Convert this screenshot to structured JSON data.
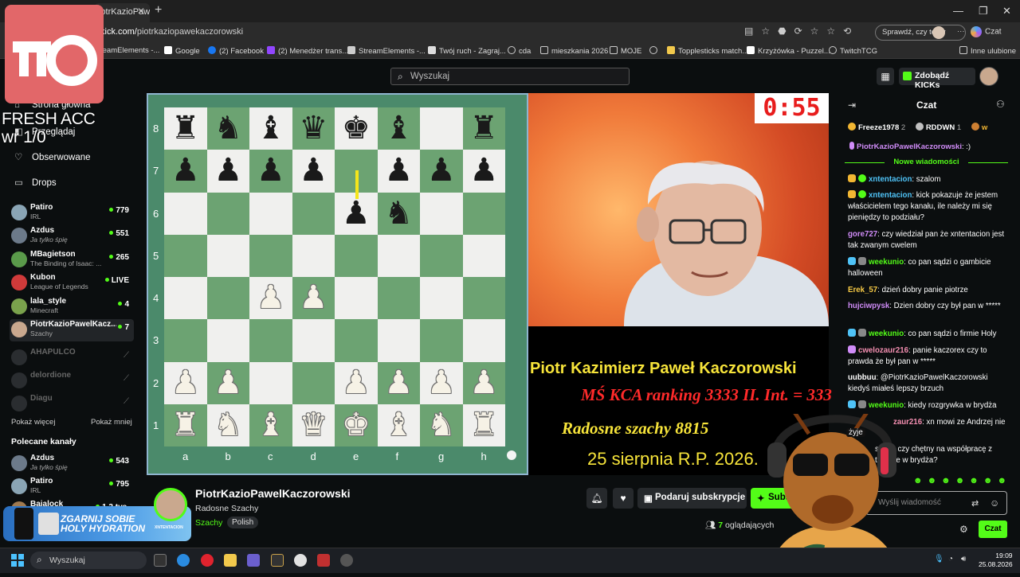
{
  "browser": {
    "tab_title": "iotrKazioPawekaczorowski S",
    "url_prefix": "kick.com/",
    "url_path": "piotrkaziopawekaczorowski",
    "sprawdz_label": "Sprawdź, czy to Ty",
    "copilot_label": "Czat",
    "bookmarks": [
      {
        "label": "teamElements -..."
      },
      {
        "label": "Google"
      },
      {
        "label": "(2) Facebook"
      },
      {
        "label": "(2) Menedżer trans..."
      },
      {
        "label": "StreamElements -..."
      },
      {
        "label": "Twój ruch - Zagraj..."
      },
      {
        "label": "cda"
      },
      {
        "label": "mieszkania 2026"
      },
      {
        "label": "MOJE"
      },
      {
        "label": "Topplesticks match..."
      },
      {
        "label": "Krzyżówka - Puzzel..."
      },
      {
        "label": "TwitchTCG"
      },
      {
        "label": "Inne ulubione"
      }
    ]
  },
  "overlay": {
    "fresh_line1": "FRESH ACC",
    "fresh_line2": "wr 1/0"
  },
  "header": {
    "search_placeholder": "Wyszukaj",
    "kicks_label": "Zdobądź KICKs"
  },
  "sidebar": {
    "nav": [
      {
        "label": "Strona główna"
      },
      {
        "label": "Przeglądaj"
      },
      {
        "label": "Obserwowane"
      },
      {
        "label": "Drops"
      }
    ],
    "followed": [
      {
        "name": "Patiro",
        "category": "IRL",
        "viewers": "779",
        "color": "#8aa5b5"
      },
      {
        "name": "Azdus",
        "category": "Ja tylko śpię",
        "viewers": "551",
        "color": "#6c7a8a"
      },
      {
        "name": "MBagietson",
        "category": "The Binding of Isaac: ...",
        "viewers": "265",
        "color": "#5a9a4a"
      },
      {
        "name": "Kubon",
        "category": "League of Legends",
        "viewers": "LIVE",
        "color": "#d03a3a"
      },
      {
        "name": "lala_style",
        "category": "Minecraft",
        "viewers": "4",
        "color": "#7aa24c"
      },
      {
        "name": "PiotrKazioPawelKacz...",
        "category": "Szachy",
        "viewers": "7",
        "color": "#c9a88e"
      }
    ],
    "offline": [
      {
        "name": "AHAPULCO"
      },
      {
        "name": "delordione"
      },
      {
        "name": "Diagu"
      }
    ],
    "show_more": "Pokaż więcej",
    "show_less": "Pokaż mniej",
    "recommended_title": "Polecane kanały",
    "recommended": [
      {
        "name": "Azdus",
        "category": "Ja tylko śpię",
        "viewers": "543",
        "color": "#6c7a8a"
      },
      {
        "name": "Patiro",
        "category": "IRL",
        "viewers": "795",
        "color": "#8aa5b5"
      },
      {
        "name": "Bajalock",
        "category": "",
        "viewers": "1,2 tys.",
        "color": "#a07a50"
      }
    ],
    "ad_line1": "ZGARNIJ SOBIE",
    "ad_line2": "HOLY HYDRATION",
    "ad_brand": "XNTENTACION"
  },
  "board": {
    "ranks": [
      "8",
      "7",
      "6",
      "5",
      "4",
      "3",
      "2",
      "1"
    ],
    "files": [
      "a",
      "b",
      "c",
      "d",
      "e",
      "f",
      "g",
      "h"
    ],
    "position": [
      [
        "r",
        "n",
        "b",
        "q",
        "k",
        "b",
        "",
        "r"
      ],
      [
        "p",
        "p",
        "p",
        "p",
        "",
        "p",
        "p",
        "p"
      ],
      [
        "",
        "",
        "",
        "",
        "p",
        "n",
        "",
        ""
      ],
      [
        "",
        "",
        "",
        "",
        "",
        "",
        "",
        ""
      ],
      [
        "",
        "",
        "P",
        "P",
        "",
        "",
        "",
        ""
      ],
      [
        "",
        "",
        "",
        "",
        "",
        "",
        "",
        ""
      ],
      [
        "P",
        "P",
        "",
        "",
        "P",
        "P",
        "P",
        "P"
      ],
      [
        "R",
        "N",
        "B",
        "Q",
        "K",
        "B",
        "N",
        "R"
      ]
    ]
  },
  "stream_overlay": {
    "timer": "0:55",
    "name_line": "Piotr Kazimierz Paweł Kaczorowski",
    "ranking_line": "MŚ KCA ranking 3333   II. Int. = 333",
    "radosne_line": "Radosne szachy 8815",
    "date_line": "25 sierpnia R.P. 2026.",
    "facecam_text": "żyje"
  },
  "stream_info": {
    "streamer": "PiotrKazioPawelKaczorowski",
    "title": "Radosne Szachy",
    "category": "Szachy",
    "tag": "Polish",
    "gift_label": "Podaruj subskrypcje",
    "sub_label": "Subskrybuj",
    "viewer_count": "7",
    "viewer_label": "oglądających"
  },
  "chat": {
    "title": "Czat",
    "leaderboard": [
      {
        "name": "Freeze1978",
        "count": "2"
      },
      {
        "name": "RDDWN",
        "count": "1"
      },
      {
        "name": "w",
        "count": ""
      }
    ],
    "pinned_user": "PiotrKazioPawelKaczorowski",
    "pinned_text": ":)",
    "new_messages_label": "Nowe wiadomości",
    "messages": [
      {
        "user": "xntentacion",
        "text": "szalom",
        "color": "#4fc3f7"
      },
      {
        "user": "xntentacion",
        "text": "kick pokazuje że jestem właścicielem tego kanału, ile należy mi się pieniędzy to podziału?",
        "color": "#4fc3f7"
      },
      {
        "user": "gore727",
        "text": "czy wiedział pan że xntentacion jest tak zwanym cwelem",
        "color": "#d08cf8"
      },
      {
        "user": "weekunio",
        "text": "co pan sądzi o gambicie halloween",
        "color": "#53fc18"
      },
      {
        "user": "Erek_57",
        "text": "dzień dobry panie piotrze",
        "color": "#f6c945"
      },
      {
        "user": "hujciwpysk",
        "text": "Dzien dobry czy był pan w *****",
        "color": "#d08cf8"
      },
      {
        "user": "weekunio",
        "text": "co pan sądzi o firmie Holy",
        "color": "#53fc18"
      },
      {
        "user": "cwelozaur216",
        "text": "panie kaczorex czy to prawda że był pan w *****",
        "color": "#f48fb1"
      },
      {
        "user": "uubbuu",
        "text": "@PiotrKazioPawelKaczorowski kiedyś miałeś lepszy brzuch",
        "color": "#ffffff"
      },
      {
        "user": "weekunio",
        "text": "kiedy rozgrywka w brydża",
        "color": "#53fc18"
      },
      {
        "user": "zaur216",
        "text": "xn mowi ze Andrzej nie",
        "color": "#f48fb1"
      },
      {
        "user": "",
        "text": "siema czy chętny na współpracę z turnieje w brydża?",
        "color": "#ffffff"
      }
    ],
    "input_placeholder": "Wyślij wiadomość",
    "send_label": "Czat"
  },
  "taskbar": {
    "search_placeholder": "Wyszukaj",
    "time": "19:09",
    "date": "25.08.2026"
  }
}
